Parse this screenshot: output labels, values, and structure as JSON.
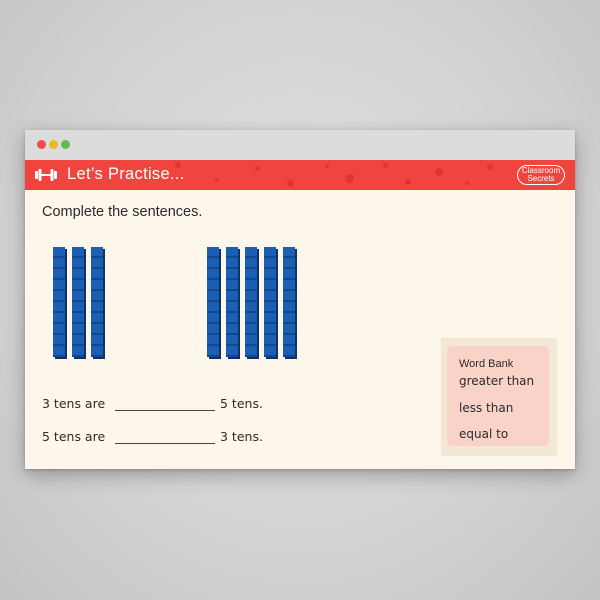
{
  "banner": {
    "title": "Let’s Practise...",
    "logo_line1": "Classroom",
    "logo_line2": "Secrets",
    "color": "#f0453e"
  },
  "instruction": "Complete the sentences.",
  "base_ten": {
    "group_a_tens": 3,
    "group_b_tens": 5,
    "rod_color": "#1a5fb4"
  },
  "sentences": [
    {
      "left": "3 tens are",
      "right": "5 tens."
    },
    {
      "left": "5 tens are",
      "right": "3 tens."
    }
  ],
  "word_bank": {
    "title": "Word Bank",
    "words": [
      "greater than",
      "less than",
      "equal to"
    ]
  },
  "window_controls": [
    "close",
    "minimize",
    "maximize"
  ]
}
